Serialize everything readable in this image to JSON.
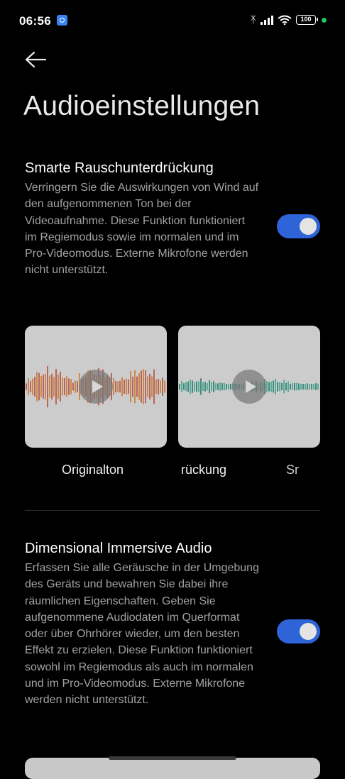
{
  "status": {
    "time": "06:56",
    "battery": "100"
  },
  "page": {
    "title": "Audioeinstellungen"
  },
  "noise_reduction": {
    "title": "Smarte Rauschunterdrückung",
    "description": "Verringern Sie die Auswirkungen von Wind auf den aufgenommenen Ton bei der Videoaufnahme. Diese Funktion funktioniert im Regiemodus sowie im normalen und im Pro-Videomodus. Externe Mikrofone werden nicht unterstützt.",
    "enabled": true
  },
  "carousel": {
    "items": [
      {
        "label": "Originalton",
        "wave_color_a": "#c9772c",
        "wave_color_b": "#b84a3a"
      },
      {
        "label": "rückung",
        "wave_color_a": "#3aa38a",
        "wave_color_b": "#1f7a6a"
      },
      {
        "label": "Sr"
      }
    ]
  },
  "immersive_audio": {
    "title": "Dimensional Immersive Audio",
    "description": "Erfassen Sie alle Geräusche in der Umgebung des Geräts und bewahren Sie dabei ihre räumlichen Eigenschaften. Geben Sie aufgenommene Audiodaten im Querformat oder über Ohrhörer wieder, um den besten Effekt zu erzielen. Diese Funktion funktioniert sowohl im Regiemodus als auch im normalen und im Pro-Videomodus. Externe Mikrofone werden nicht unterstützt.",
    "enabled": true
  },
  "colors": {
    "accent": "#2f64d9",
    "background": "#000000",
    "secondary_text": "#a2a2a2"
  }
}
